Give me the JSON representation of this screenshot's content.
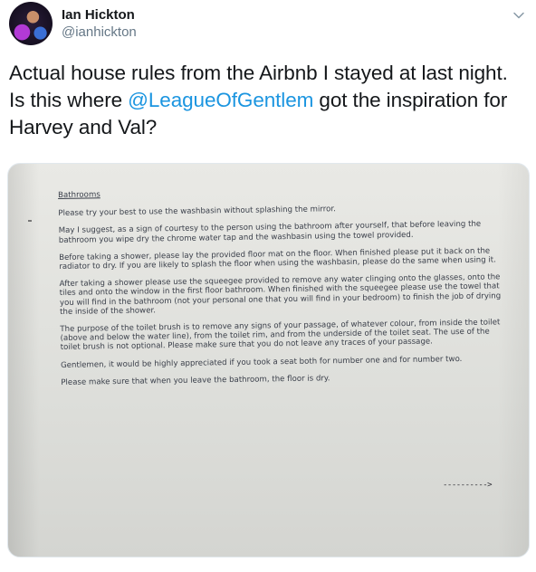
{
  "tweet": {
    "display_name": "Ian Hickton",
    "handle": "@ianhickton",
    "text_before": "Actual house rules from the Airbnb I stayed at last night. Is this where ",
    "mention": "@LeagueOfGentlem",
    "text_after": " got the inspiration for Harvey and Val?",
    "icons": {
      "menu": "chevron-down-icon",
      "avatar": "avatar"
    }
  },
  "photo": {
    "heading": "Bathrooms",
    "paragraphs": [
      "Please try your best to use the washbasin without splashing the mirror.",
      "May I suggest, as a sign of courtesy to the person using the bathroom after yourself, that before leaving the bathroom you wipe dry the chrome water tap and the washbasin using the towel provided.",
      "Before taking a shower, please  lay the provided floor mat on the floor. When finished please put it back on the radiator to dry. If you are likely to splash the floor when using the washbasin, please do the same when using it.",
      "After taking a shower please use the squeegee provided to remove any water clinging onto the glasses, onto the tiles and onto the window in the first floor bathroom. When finished with the squeegee please use the towel that you will find in the bathroom (not your personal one that you will find in your bedroom) to finish the job of drying the inside of the shower.",
      "The purpose of the toilet brush is to remove any signs of your passage, of whatever colour, from inside the toilet (above and below the water line), from the toilet rim, and from the underside of the toilet seat. The use of the toilet brush is not optional. Please make sure that you do not leave any traces of your passage.",
      "Gentlemen, it would be highly appreciated if you took a seat both for number one and for number two.",
      "Please make sure that when you leave the bathroom, the floor is dry."
    ],
    "arrow": "---------->"
  }
}
